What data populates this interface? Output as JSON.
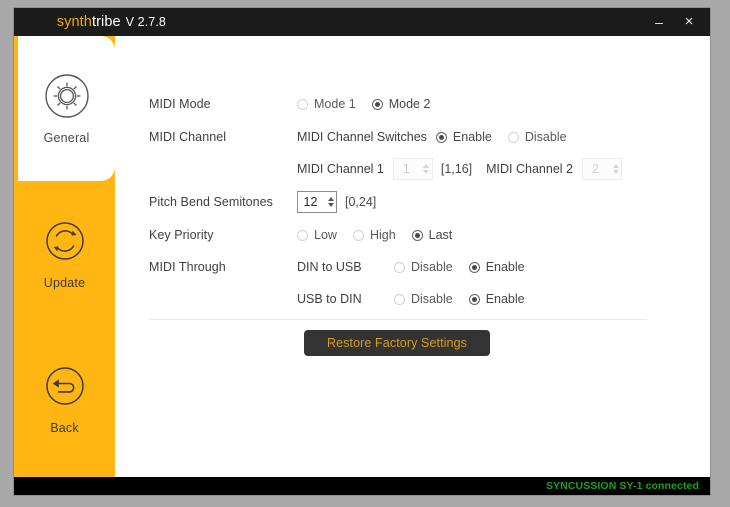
{
  "window": {
    "title_brand_1": "synth",
    "title_brand_2": "tribe",
    "version": "V 2.7.8",
    "minimize_label": "–",
    "close_label": "×"
  },
  "colors": {
    "accent_orange": "#ffb612",
    "brand_orange": "#f6a800",
    "titlebar": "#1b1b1b",
    "button_bg": "#333333",
    "button_text": "#d99a1e",
    "status_green": "#1ea01e",
    "desktop": "#a9a9a9"
  },
  "sidebar": {
    "items": [
      {
        "label": "General",
        "icon": "gear-icon",
        "active": true
      },
      {
        "label": "Update",
        "icon": "refresh-circle-icon",
        "active": false
      },
      {
        "label": "Back",
        "icon": "back-arrow-icon",
        "active": false
      }
    ]
  },
  "form": {
    "midi_mode": {
      "label": "MIDI Mode",
      "options": [
        {
          "label": "Mode 1",
          "selected": false
        },
        {
          "label": "Mode 2",
          "selected": true
        }
      ]
    },
    "midi_channel": {
      "label": "MIDI Channel",
      "switches_label": "MIDI Channel Switches",
      "switch_options": [
        {
          "label": "Enable",
          "selected": true
        },
        {
          "label": "Disable",
          "selected": false
        }
      ],
      "channel_1_label": "MIDI Channel 1",
      "channel_1_value": "1",
      "channel_1_range": "[1,16]",
      "channel_2_label": "MIDI Channel 2",
      "channel_2_value": "2"
    },
    "pitch_bend": {
      "label": "Pitch Bend Semitones",
      "value": "12",
      "range": "[0,24]"
    },
    "key_priority": {
      "label": "Key Priority",
      "options": [
        {
          "label": "Low",
          "selected": false
        },
        {
          "label": "High",
          "selected": false
        },
        {
          "label": "Last",
          "selected": true
        }
      ]
    },
    "midi_through": {
      "label": "MIDI Through",
      "din_to_usb_label": "DIN to USB",
      "din_to_usb_options": [
        {
          "label": "Disable",
          "selected": false
        },
        {
          "label": "Enable",
          "selected": true
        }
      ],
      "usb_to_din_label": "USB to DIN",
      "usb_to_din_options": [
        {
          "label": "Disable",
          "selected": false
        },
        {
          "label": "Enable",
          "selected": true
        }
      ]
    },
    "restore_button_label": "Restore Factory Settings"
  },
  "status": {
    "text": "SYNCUSSION SY-1 connected"
  }
}
